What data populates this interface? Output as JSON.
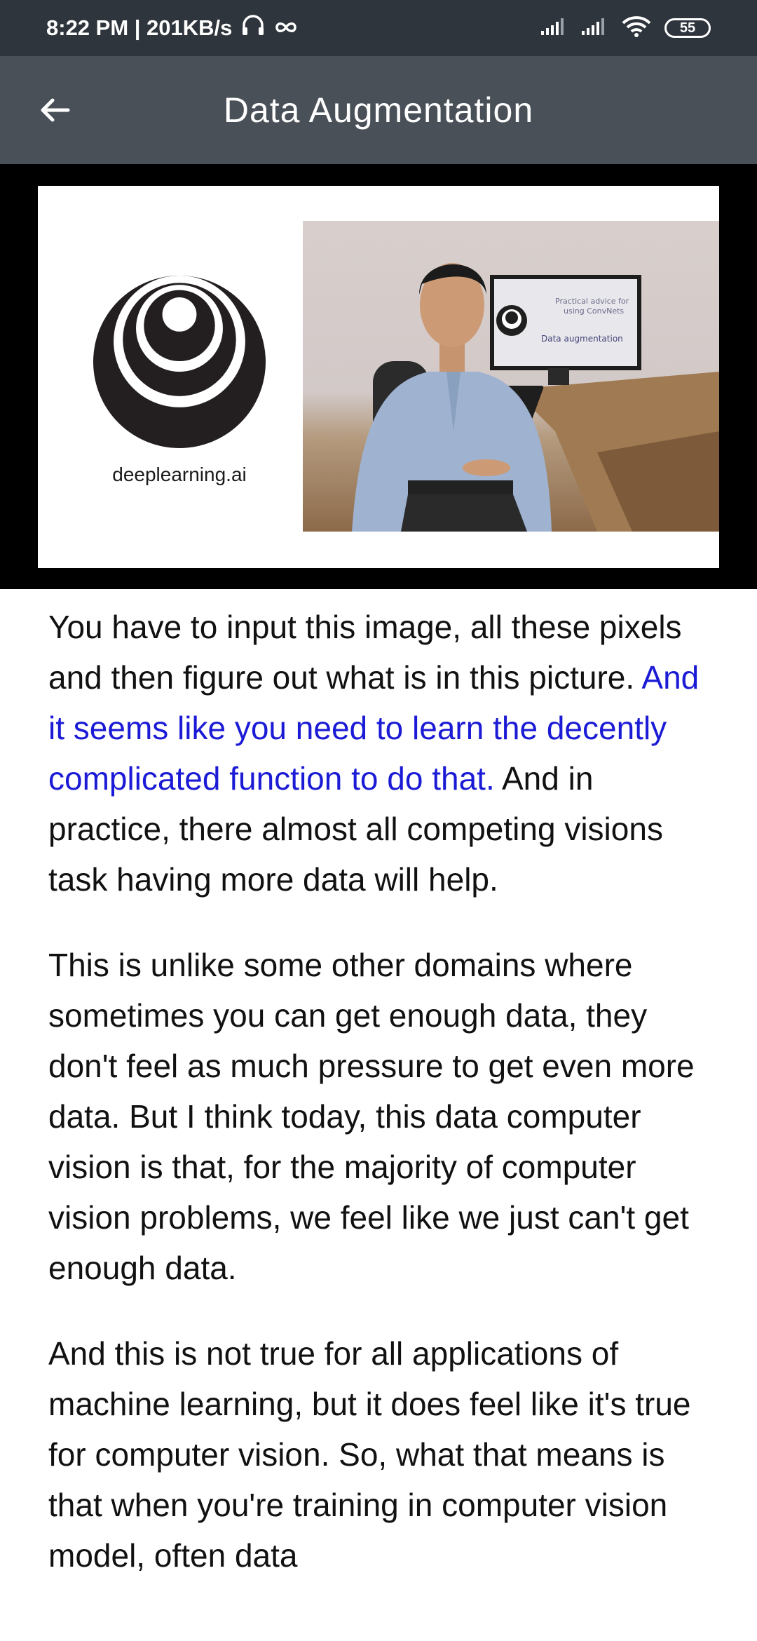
{
  "status_bar": {
    "time_speed": "8:22 PM | 201KB/s",
    "headphone_icon": "headphone-icon",
    "infinity_icon": "infinity-icon",
    "battery": "55"
  },
  "app_bar": {
    "title": "Data Augmentation",
    "back_icon": "back-arrow-icon"
  },
  "video": {
    "logo_text": "deeplearning.ai",
    "screen_line1": "Practical advice for",
    "screen_line2": "using ConvNets",
    "screen_line3": "Data augmentation"
  },
  "transcript": {
    "p1_plain": "You have to input this image, all these pixels and then figure out what is in this picture. ",
    "p1_highlight": "And it seems like you need to learn the decently complicated function to do that.",
    "p1_rest": " And in practice, there almost all competing visions task having more data will help.",
    "p2": "This is unlike some other domains where sometimes you can get enough data, they don't feel as much pressure to get even more data. But I think today, this data computer vision is that, for the majority of computer vision problems, we feel like we just can't get enough data.",
    "p3": "And this is not true for all applications of machine learning, but it does feel like it's true for computer vision. So, what that means is that when you're training in computer vision model, often data"
  },
  "colors": {
    "status_bar": "#2f353c",
    "app_bar": "#4a5058",
    "highlight": "#1b1bd6"
  }
}
